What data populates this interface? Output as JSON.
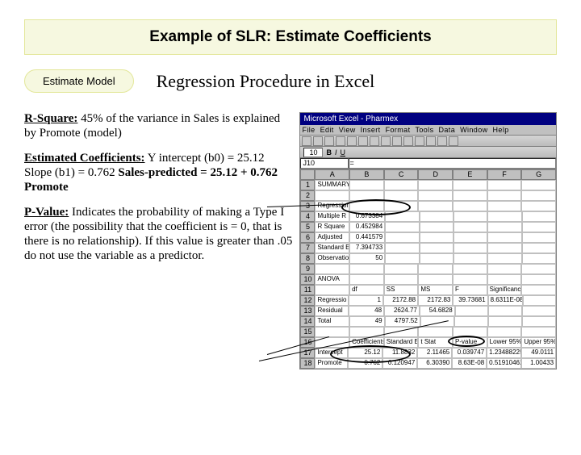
{
  "title": "Example of SLR:  Estimate Coefficients",
  "pill_label": "Estimate Model",
  "subtitle": "Regression Procedure in Excel",
  "rsquare": {
    "label": "R-Square:",
    "text": " 45% of the variance in Sales is explained by Promote (model)"
  },
  "coeff": {
    "label": "Estimated Coefficients:",
    "line1_a": " Y intercept (b0) = 25.12 ",
    "line1_b": "Slope (b1) = 0.762 ",
    "eq_label": "Sales-predicted = 25.12 + 0.762 Promote"
  },
  "pval": {
    "label": "P-Value:",
    "text": " Indicates the probability of making a Type I error (the possibility that the coefficient is = 0, that is there is no relationship). If this value is greater than .05 do not use the variable as a predictor."
  },
  "excel": {
    "titlebar": "Microsoft Excel - Pharmex",
    "menu": [
      "File",
      "Edit",
      "View",
      "Insert",
      "Format",
      "Tools",
      "Data",
      "Window",
      "Help"
    ],
    "font_box": "10",
    "namebox": "J10",
    "cols": [
      "A",
      "B",
      "C",
      "D",
      "E",
      "F",
      "G"
    ],
    "rows": [
      {
        "n": "1",
        "cells": [
          "SUMMARY OUTPUT",
          "",
          "",
          "",
          "",
          "",
          ""
        ]
      },
      {
        "n": "2",
        "cells": [
          "",
          "",
          "",
          "",
          "",
          "",
          ""
        ]
      },
      {
        "n": "3",
        "cells": [
          "Regression Statistics",
          "",
          "",
          "",
          "",
          "",
          ""
        ]
      },
      {
        "n": "4",
        "cells": [
          "Multiple R",
          "0.673384",
          "",
          "",
          "",
          "",
          ""
        ]
      },
      {
        "n": "5",
        "cells": [
          "R Square",
          "0.452984",
          "",
          "",
          "",
          "",
          ""
        ]
      },
      {
        "n": "6",
        "cells": [
          "Adjusted",
          "0.441579",
          "",
          "",
          "",
          "",
          ""
        ]
      },
      {
        "n": "7",
        "cells": [
          "Standard E",
          "7.394733",
          "",
          "",
          "",
          "",
          ""
        ]
      },
      {
        "n": "8",
        "cells": [
          "Observatio",
          "50",
          "",
          "",
          "",
          "",
          ""
        ]
      },
      {
        "n": "9",
        "cells": [
          "",
          "",
          "",
          "",
          "",
          "",
          ""
        ]
      },
      {
        "n": "10",
        "cells": [
          "ANOVA",
          "",
          "",
          "",
          "",
          "",
          ""
        ]
      },
      {
        "n": "11",
        "cells": [
          "",
          "df",
          "SS",
          "MS",
          "F",
          "Significance F",
          ""
        ]
      },
      {
        "n": "12",
        "cells": [
          "Regressio",
          "1",
          "2172.88",
          "2172.83",
          "39.73681",
          "8.6311E-08",
          ""
        ]
      },
      {
        "n": "13",
        "cells": [
          "Residual",
          "48",
          "2624.77",
          "54.6828",
          "",
          "",
          ""
        ]
      },
      {
        "n": "14",
        "cells": [
          "Total",
          "49",
          "4797.52",
          "",
          "",
          "",
          ""
        ]
      },
      {
        "n": "15",
        "cells": [
          "",
          "",
          "",
          "",
          "",
          "",
          ""
        ]
      },
      {
        "n": "16",
        "cells": [
          "",
          "Coefficients",
          "Standard Err",
          "t Stat",
          "P-value",
          "Lower 95%",
          "Upper 95%"
        ]
      },
      {
        "n": "17",
        "cells": [
          "Intercept",
          "25.12",
          "11.8832",
          "2.11465",
          "0.039747",
          "1.23488225",
          "49.0111"
        ]
      },
      {
        "n": "18",
        "cells": [
          "Promote",
          "0.762",
          "0.120947",
          "6.30390",
          "8.63E-08",
          "0.51910462",
          "1.00433"
        ]
      }
    ]
  }
}
